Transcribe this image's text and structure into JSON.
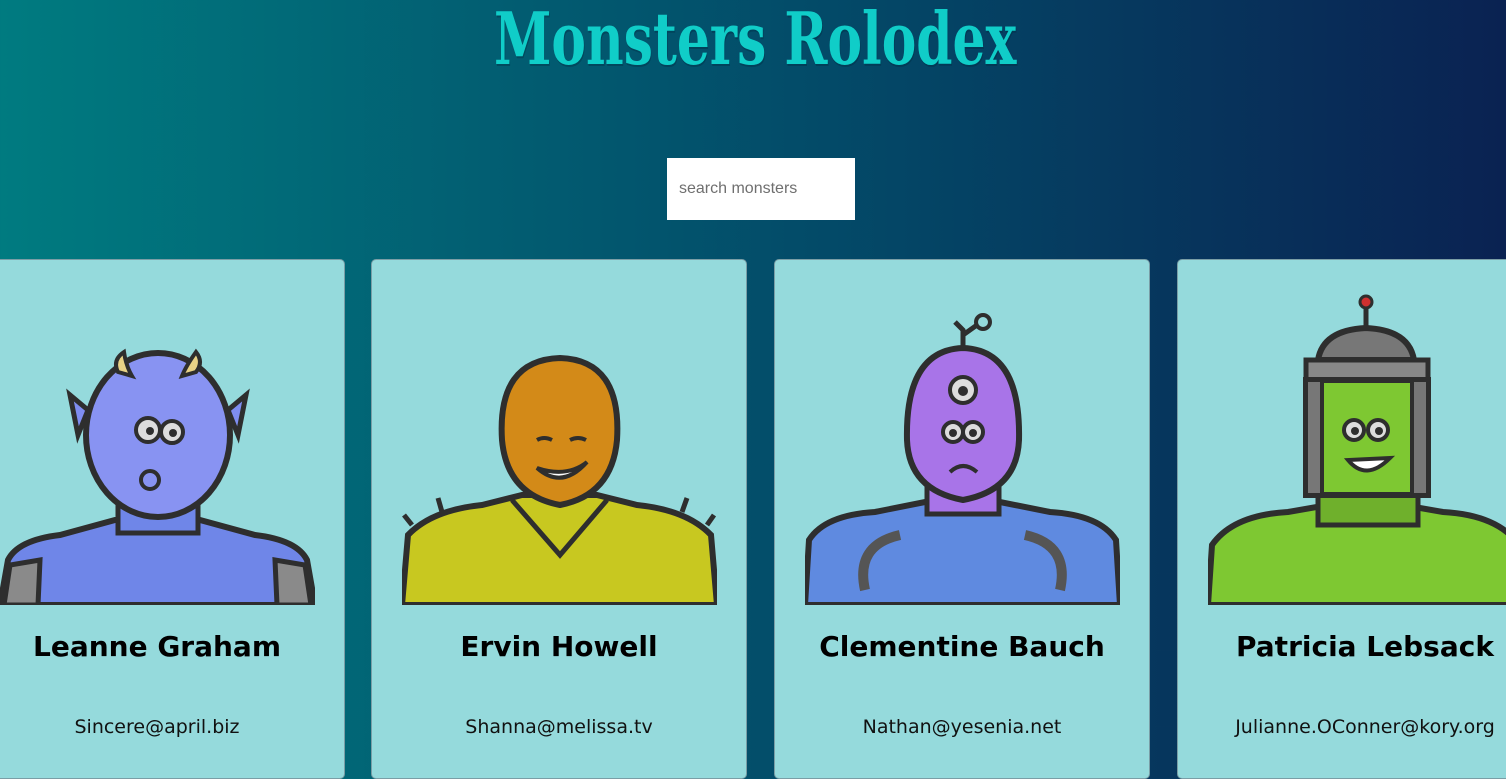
{
  "header": {
    "title": "Monsters Rolodex"
  },
  "search": {
    "placeholder": "search monsters",
    "value": ""
  },
  "monsters": [
    {
      "name": "Leanne Graham",
      "email": "Sincere@april.biz",
      "avatar_icon": "monster-avatar-blue-horned",
      "color": "#7f8df0"
    },
    {
      "name": "Ervin Howell",
      "email": "Shanna@melissa.tv",
      "avatar_icon": "monster-avatar-orange-spiky",
      "color": "#d38a18"
    },
    {
      "name": "Clementine Bauch",
      "email": "Nathan@yesenia.net",
      "avatar_icon": "monster-avatar-purple-cyclops",
      "color": "#a874e8"
    },
    {
      "name": "Patricia Lebsack",
      "email": "Julianne.OConner@kory.org",
      "avatar_icon": "monster-avatar-green-robot",
      "color": "#7ec832"
    }
  ]
}
